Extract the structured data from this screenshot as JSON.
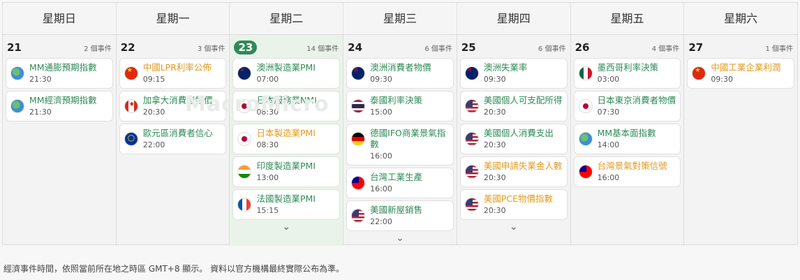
{
  "weekdays": [
    "星期日",
    "星期一",
    "星期二",
    "星期三",
    "星期四",
    "星期五",
    "星期六"
  ],
  "days": [
    {
      "num": "21",
      "count": "2 個事件",
      "events": [
        {
          "name": "MM通膨預期指數",
          "time": "21:30",
          "flag": "globe",
          "color": "green"
        },
        {
          "name": "MM經濟預期指數",
          "time": "21:30",
          "flag": "globe",
          "color": "green"
        }
      ]
    },
    {
      "num": "22",
      "count": "3 個事件",
      "events": [
        {
          "name": "中國LPR利率公佈",
          "time": "09:15",
          "flag": "cn",
          "color": "orange"
        },
        {
          "name": "加拿大消費者物價",
          "time": "20:30",
          "flag": "ca",
          "color": "green"
        },
        {
          "name": "歐元區消費者信心",
          "time": "22:00",
          "flag": "eu",
          "color": "green"
        }
      ]
    },
    {
      "num": "23",
      "count": "14 個事件",
      "today": true,
      "events": [
        {
          "name": "澳洲製造業PMI",
          "time": "07:00",
          "flag": "au",
          "color": "green"
        },
        {
          "name": "日本服務業NMI",
          "time": "08:30",
          "flag": "jp",
          "color": "green"
        },
        {
          "name": "日本製造業PMI",
          "time": "08:30",
          "flag": "jp",
          "color": "orange"
        },
        {
          "name": "印度製造業PMI",
          "time": "13:00",
          "flag": "in",
          "color": "green"
        },
        {
          "name": "法國製造業PMI",
          "time": "15:15",
          "flag": "fr",
          "color": "green"
        }
      ],
      "more": "⌄"
    },
    {
      "num": "24",
      "count": "6 個事件",
      "events": [
        {
          "name": "澳洲消費者物價",
          "time": "09:30",
          "flag": "au",
          "color": "green"
        },
        {
          "name": "泰國利率決策",
          "time": "15:00",
          "flag": "th",
          "color": "green"
        },
        {
          "name": "德國IFO商業景氣指數",
          "time": "16:00",
          "flag": "de",
          "color": "green"
        },
        {
          "name": "台灣工業生產",
          "time": "16:00",
          "flag": "tw",
          "color": "green"
        },
        {
          "name": "美國新屋銷售",
          "time": "22:00",
          "flag": "us",
          "color": "green"
        }
      ],
      "more": "⌄"
    },
    {
      "num": "25",
      "count": "6 個事件",
      "events": [
        {
          "name": "澳洲失業率",
          "time": "09:30",
          "flag": "au",
          "color": "green"
        },
        {
          "name": "美國個人可支配所得",
          "time": "20:30",
          "flag": "us",
          "color": "green"
        },
        {
          "name": "美國個人消費支出",
          "time": "20:30",
          "flag": "us",
          "color": "green"
        },
        {
          "name": "美國申請失業金人數",
          "time": "20:30",
          "flag": "us",
          "color": "orange"
        },
        {
          "name": "美國PCE物價指數",
          "time": "20:30",
          "flag": "us",
          "color": "orange"
        }
      ],
      "more": "⌄"
    },
    {
      "num": "26",
      "count": "4 個事件",
      "events": [
        {
          "name": "墨西哥利率決策",
          "time": "03:00",
          "flag": "mx",
          "color": "green"
        },
        {
          "name": "日本東京消費者物價",
          "time": "07:30",
          "flag": "jp",
          "color": "green"
        },
        {
          "name": "MM基本面指數",
          "time": "14:00",
          "flag": "globe",
          "color": "green"
        },
        {
          "name": "台灣景氣對策信號",
          "time": "16:00",
          "flag": "tw",
          "color": "orange"
        }
      ]
    },
    {
      "num": "27",
      "count": "1 個事件",
      "events": [
        {
          "name": "中國工業企業利潤",
          "time": "09:30",
          "flag": "cn",
          "color": "orange"
        }
      ]
    }
  ],
  "watermark": "MacroMicro",
  "footer": "經濟事件時間，依照當前所在地之時區 GMT+8 顯示。 資料以官方機構最終實際公布為準。",
  "colors": {
    "green": "#2e8b57",
    "orange": "#e49a1c",
    "today_bg": "#eaf3ea"
  }
}
